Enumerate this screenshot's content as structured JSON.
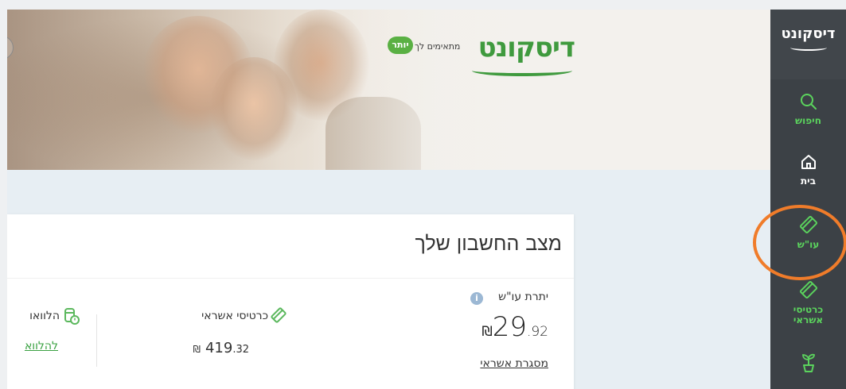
{
  "hero": {
    "brand_name": "דיסקונט",
    "tagline": "מתאימים לך",
    "badge": "יותר"
  },
  "sidebar": {
    "logo": "דיסקונט",
    "items": [
      {
        "label": "חיפוש",
        "icon": "search-icon"
      },
      {
        "label": "בית",
        "icon": "home-icon"
      },
      {
        "label": "עו\"ש",
        "icon": "checking-account-icon"
      },
      {
        "label": "כרטיסי אשראי",
        "icon": "credit-card-icon"
      },
      {
        "label": "",
        "icon": "plant-icon"
      }
    ]
  },
  "account_card": {
    "title": "מצב החשבון שלך",
    "balance": {
      "label": "יתרת עו\"ש",
      "integer": "29",
      "decimal": ".92",
      "currency": "₪",
      "credit_link": "מסגרת אשראי"
    },
    "credit_cards": {
      "label": "כרטיסי אשראי",
      "integer": "419",
      "decimal": ".32",
      "currency": "₪"
    },
    "loans": {
      "label": "הלוואו",
      "link": "להלווא"
    }
  },
  "colors": {
    "brand_green": "#3f9a3e",
    "nav_active_green": "#5bd35d",
    "sidebar_bg": "#3c4146",
    "annotation_orange": "#f07c2a"
  }
}
